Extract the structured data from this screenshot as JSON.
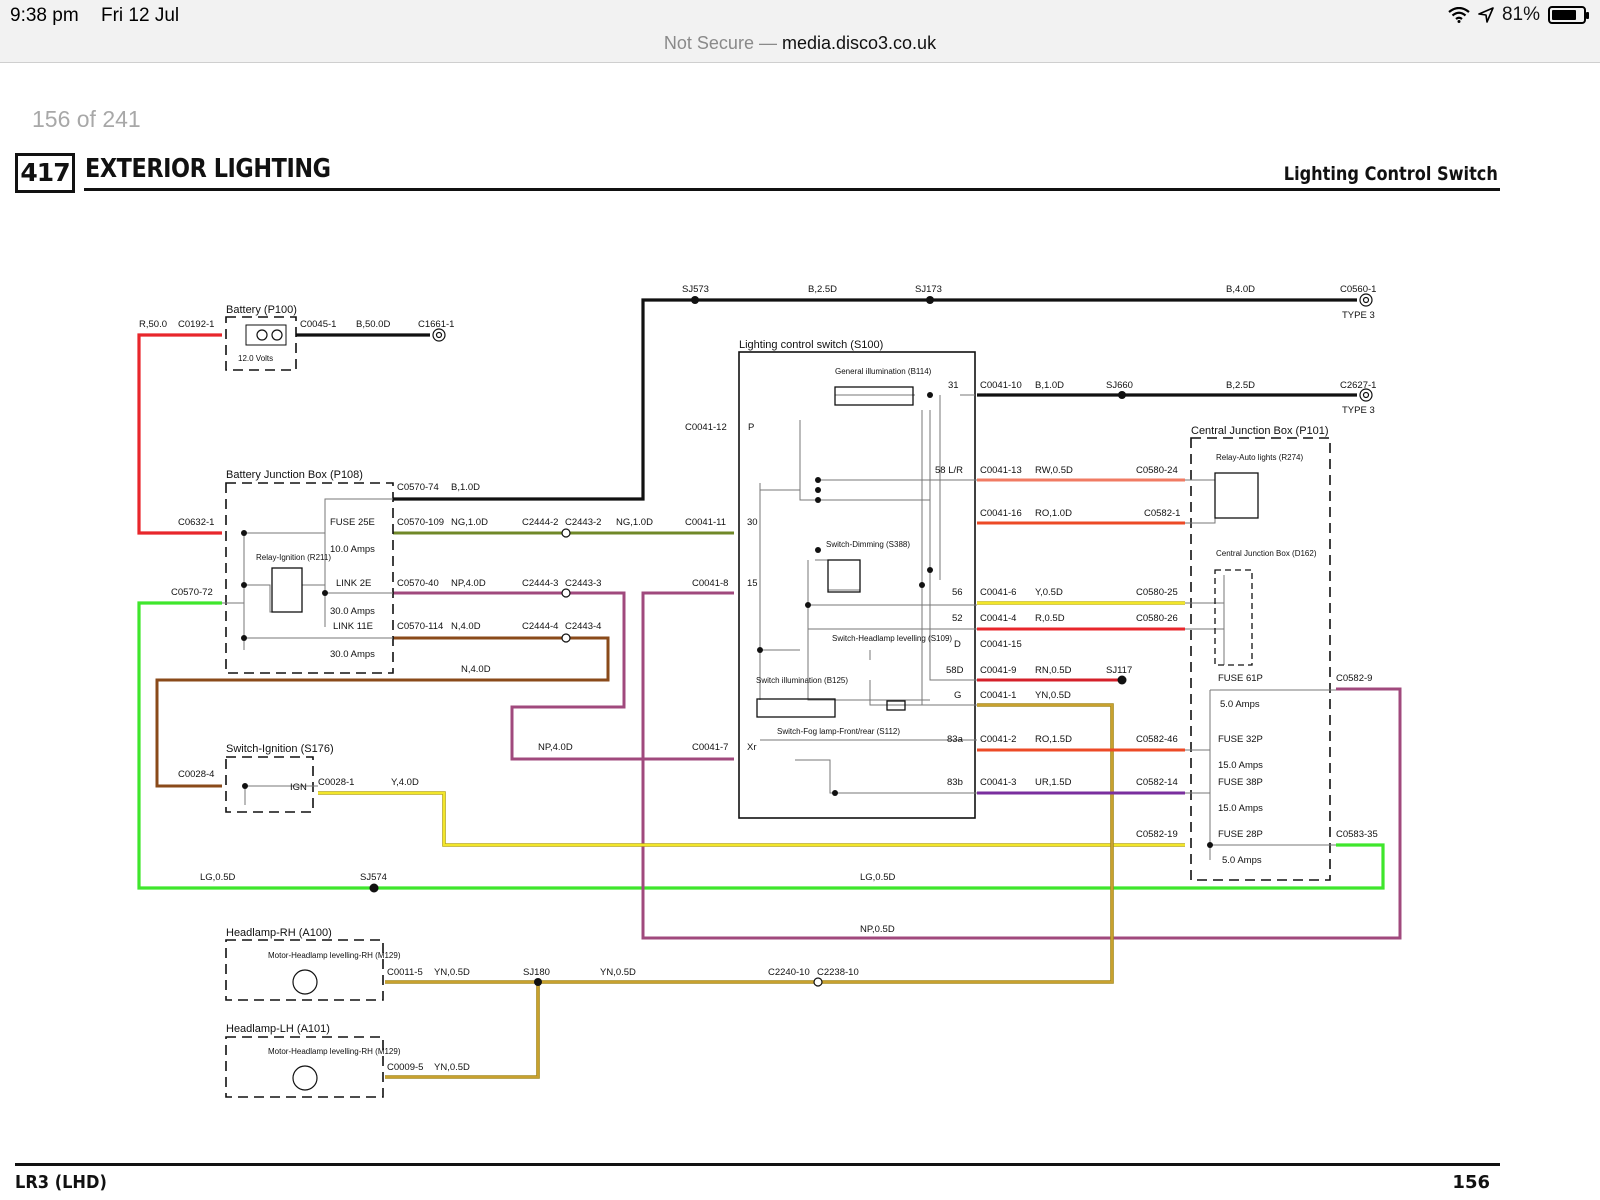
{
  "status_bar": {
    "time": "9:38 pm",
    "date": "Fri 12 Jul",
    "battery": "81%",
    "battery_fraction": 0.81
  },
  "url_bar": {
    "security": "Not Secure",
    "separator": "—",
    "host": "media.disco3.co.uk"
  },
  "page_counter": "156 of 241",
  "header": {
    "section_number": "417",
    "section_title": "EXTERIOR LIGHTING",
    "subtitle": "Lighting Control Switch"
  },
  "footer": {
    "model": "LR3 (LHD)",
    "page": "156"
  },
  "colors": {
    "red": "#e8262b",
    "black": "#111111",
    "green": "#3fe62c",
    "olive": "#708828",
    "purple": "#a0497d",
    "brown": "#8a4a1a",
    "yellow": "#f2e62a",
    "yellow_dark": "#b8a81a",
    "salmon": "#f07b63",
    "orange_red": "#ec4a26",
    "violet": "#7a2f9e",
    "mustard": "#c9a12e",
    "gray": "#8a8a8a"
  },
  "components": {
    "battery": {
      "title": "Battery (P100)",
      "voltage": "12.0 Volts"
    },
    "bjb": {
      "title": "Battery Junction Box (P108)",
      "fuse_25e": "FUSE 25E",
      "fuse_25e_rating": "10.0 Amps",
      "relay_ignition": "Relay-Ignition (R211)",
      "link_2e": "LINK 2E",
      "link_2e_rating": "30.0 Amps",
      "link_11e": "LINK 11E",
      "link_11e_rating": "30.0 Amps"
    },
    "ignition_switch": {
      "title": "Switch-Ignition (S176)",
      "ign": "IGN"
    },
    "lcs": {
      "title": "Lighting control switch (S100)",
      "general_illum": "General illumination (B114)",
      "dimming": "Switch-Dimming (S388)",
      "headlamp_levelling": "Switch-Headlamp levelling (S109)",
      "switch_illum": "Switch illumination (B125)",
      "fog_switch": "Switch-Fog lamp-Front/rear (S112)",
      "pins": {
        "p": "P",
        "p30": "30",
        "p15": "15",
        "xr": "Xr",
        "p31": "31",
        "p58lr": "58 L/R",
        "p56": "56",
        "p52": "52",
        "pD": "D",
        "p58D": "58D",
        "pG": "G",
        "p83a": "83a",
        "p83b": "83b"
      }
    },
    "cjb": {
      "title": "Central Junction Box (P101)",
      "relay_auto": "Relay-Auto lights (R274)",
      "cjb_d162": "Central Junction Box (D162)",
      "fuse_61p": "FUSE 61P",
      "fuse_61p_rating": "5.0 Amps",
      "fuse_32p": "FUSE 32P",
      "fuse_32p_rating": "15.0 Amps",
      "fuse_38p": "FUSE 38P",
      "fuse_38p_rating": "15.0 Amps",
      "fuse_28p": "FUSE 28P",
      "fuse_28p_rating": "5.0 Amps"
    },
    "headlamp_rh": {
      "title": "Headlamp-RH (A100)",
      "motor": "Motor-Headlamp levelling-RH (M129)"
    },
    "headlamp_lh": {
      "title": "Headlamp-LH (A101)",
      "motor": "Motor-Headlamp levelling-RH (M129)"
    }
  },
  "labels": {
    "r50": "R,50.0",
    "c0192_1": "C0192-1",
    "c0045_1": "C0045-1",
    "b50d": "B,50.0D",
    "c1661_1": "C1661-1",
    "sj573": "SJ573",
    "b25d_top": "B,2.5D",
    "sj173": "SJ173",
    "b40d": "B,4.0D",
    "c0560_1": "C0560-1",
    "type3_a": "TYPE 3",
    "c0041_10": "C0041-10",
    "b10d": "B,1.0D",
    "sj660": "SJ660",
    "b25d_2": "B,2.5D",
    "c2627_1": "C2627-1",
    "type3_b": "TYPE 3",
    "c0570_74": "C0570-74",
    "b10d_bjb": "B,1.0D",
    "c0632_1": "C0632-1",
    "c0570_109": "C0570-109",
    "ng10d": "NG,1.0D",
    "c2444_2": "C2444-2",
    "c2443_2": "C2443-2",
    "ng10d_b": "NG,1.0D",
    "c0041_11": "C0041-11",
    "c0570_72": "C0570-72",
    "c0570_40": "C0570-40",
    "np40d": "NP,4.0D",
    "c2444_3": "C2444-3",
    "c2443_3": "C2443-3",
    "c0041_8": "C0041-8",
    "c0570_114": "C0570-114",
    "n40d": "N,4.0D",
    "c2444_4": "C2444-4",
    "c2443_4": "C2443-4",
    "n40d_b": "N,4.0D",
    "c0041_12": "C0041-12",
    "np40d_b": "NP,4.0D",
    "c0041_7": "C0041-7",
    "c0028_4": "C0028-4",
    "c0028_1": "C0028-1",
    "y40d": "Y,4.0D",
    "c0041_13": "C0041-13",
    "rw05d": "RW,0.5D",
    "c0580_24": "C0580-24",
    "c0041_16": "C0041-16",
    "ro10d": "RO,1.0D",
    "c0582_1": "C0582-1",
    "c0041_6": "C0041-6",
    "y05d": "Y,0.5D",
    "c0580_25": "C0580-25",
    "c0041_4": "C0041-4",
    "r05d": "R,0.5D",
    "c0580_26": "C0580-26",
    "c0041_15": "C0041-15",
    "c0041_9": "C0041-9",
    "rn05d": "RN,0.5D",
    "sj117": "SJ117",
    "c0041_1": "C0041-1",
    "yn05d": "YN,0.5D",
    "c0041_2": "C0041-2",
    "ro15d": "RO,1.5D",
    "c0582_46": "C0582-46",
    "c0041_3": "C0041-3",
    "ur15d": "UR,1.5D",
    "c0582_14": "C0582-14",
    "c0582_19": "C0582-19",
    "c0582_9": "C0582-9",
    "c0583_35": "C0583-35",
    "lg05d": "LG,0.5D",
    "sj574": "SJ574",
    "lg05d_b": "LG,0.5D",
    "np05d": "NP,0.5D",
    "c0011_5": "C0011-5",
    "yn05d_b": "YN,0.5D",
    "sj180": "SJ180",
    "yn05d_c": "YN,0.5D",
    "c2240_10": "C2240-10",
    "c2238_10": "C2238-10",
    "c0009_5": "C0009-5",
    "yn05d_d": "YN,0.5D"
  }
}
